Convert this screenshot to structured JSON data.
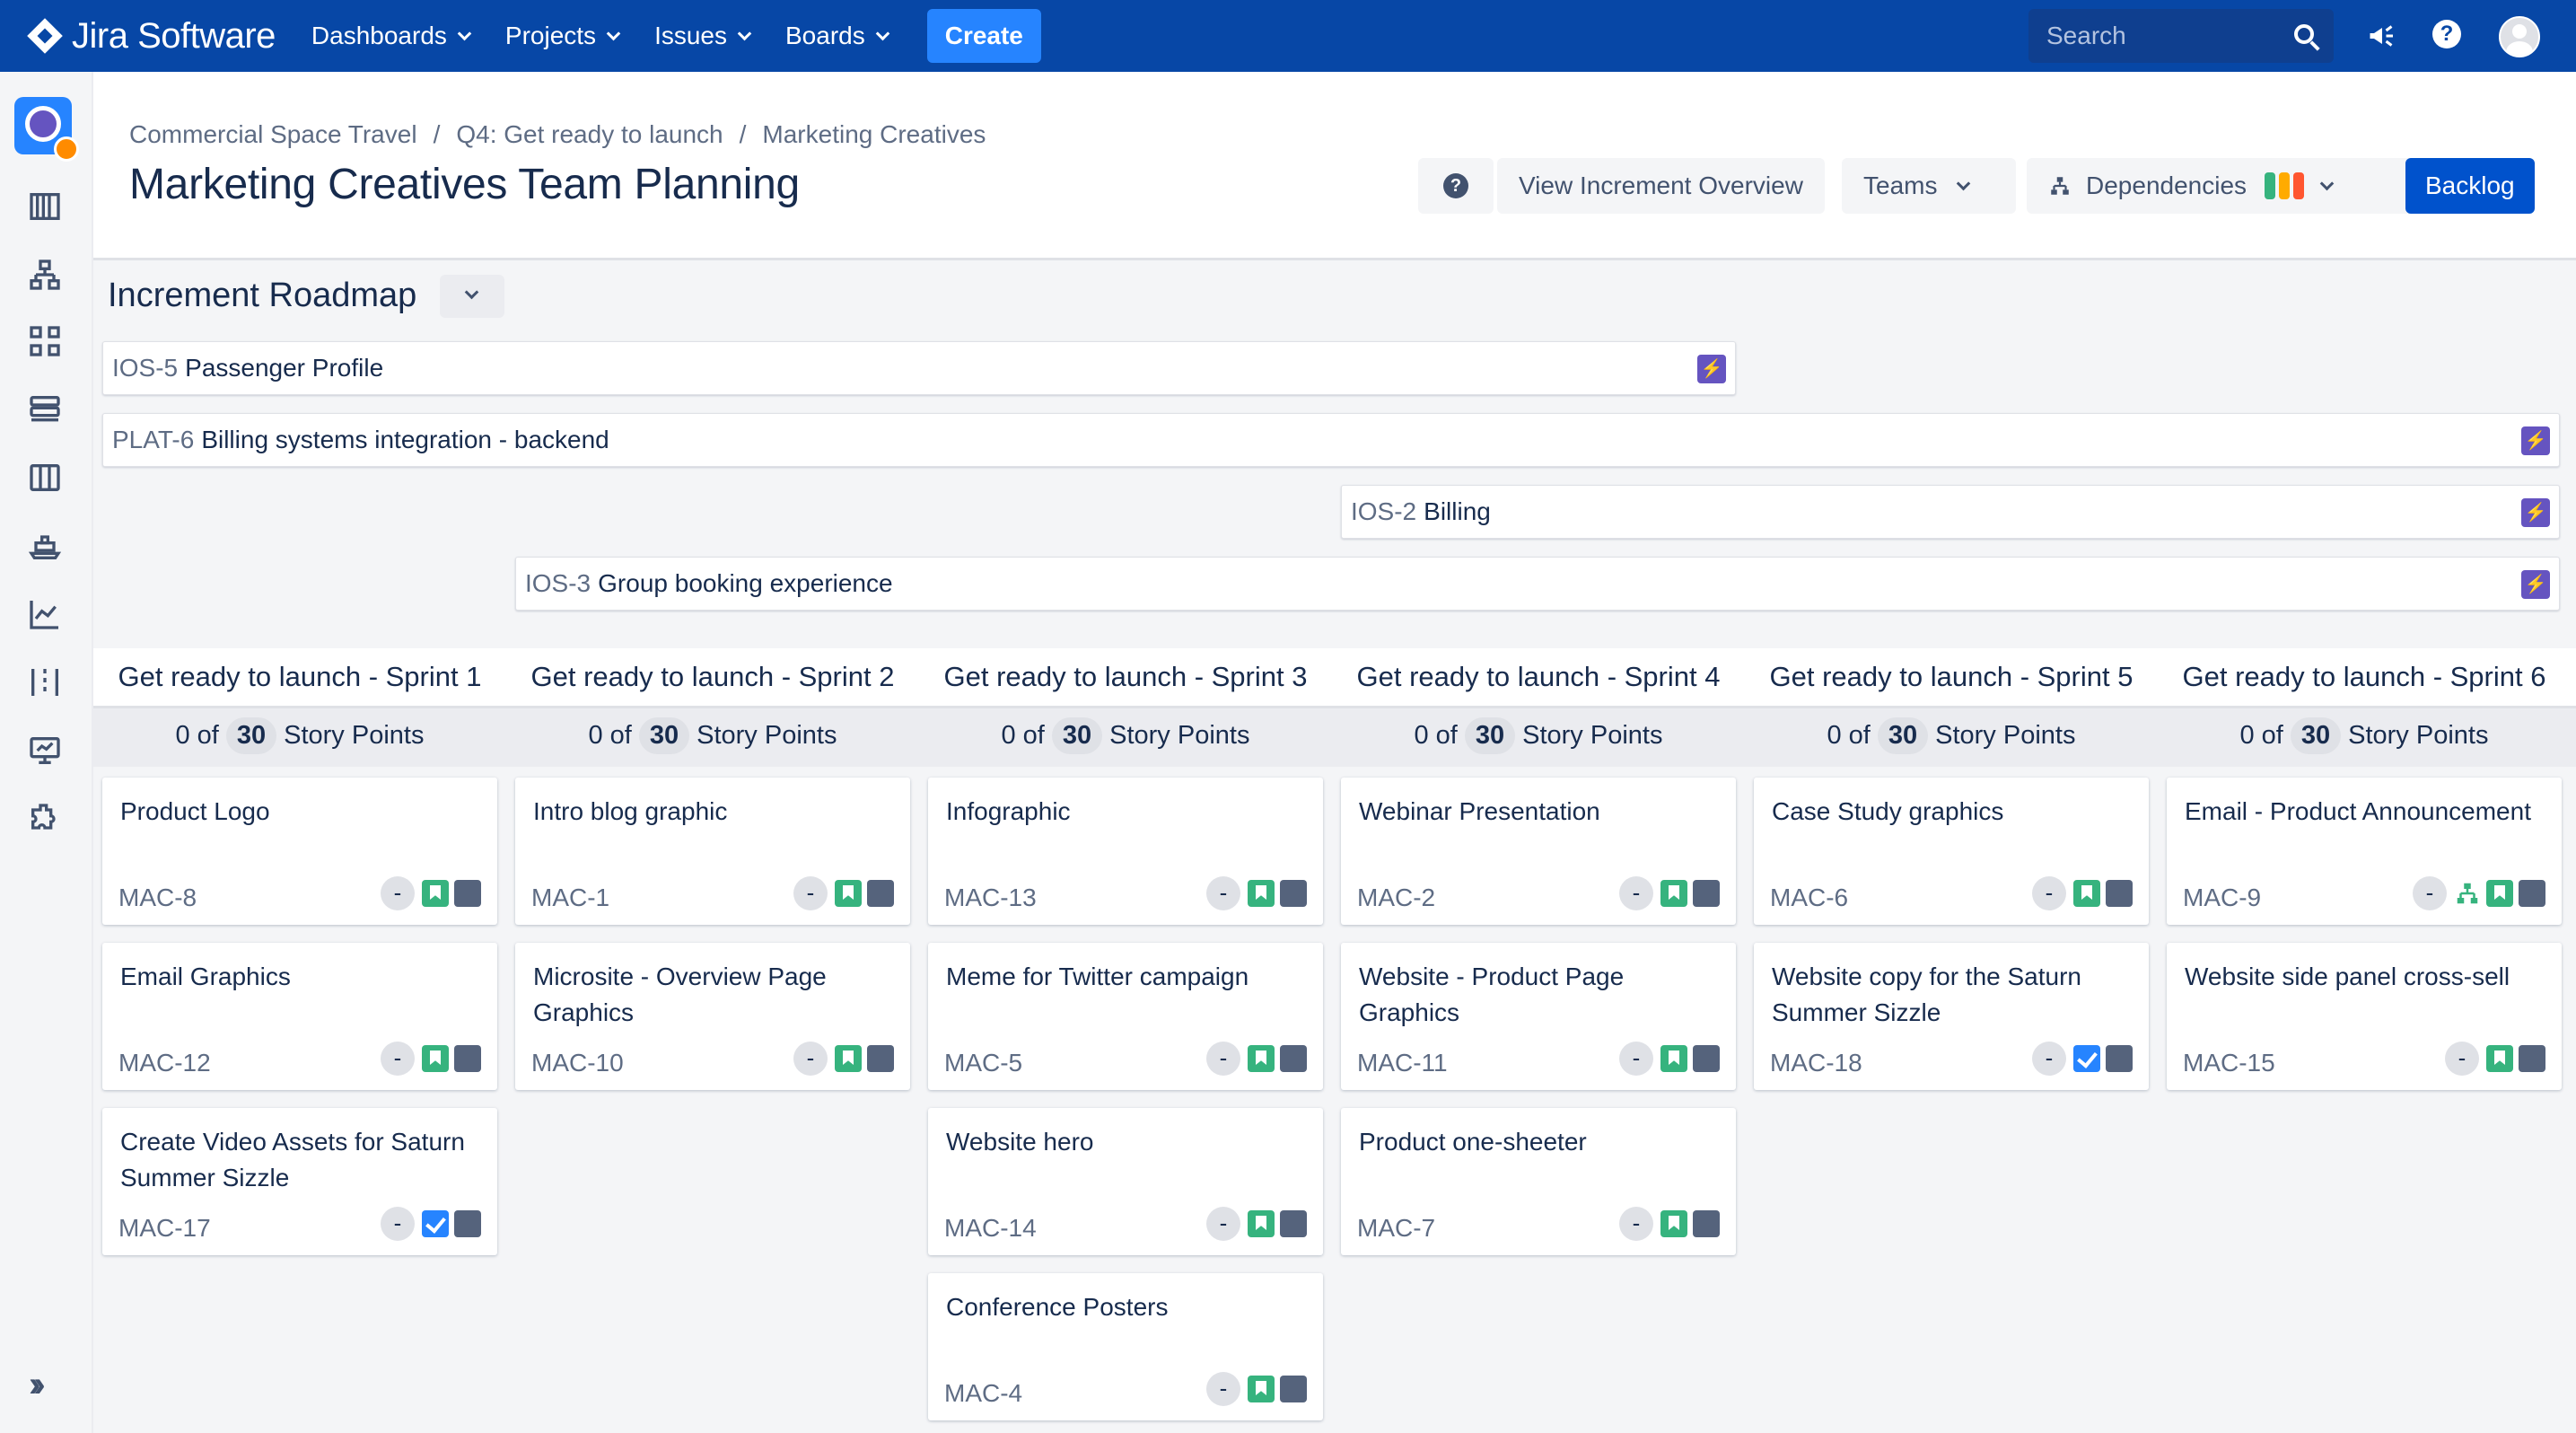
{
  "topnav": {
    "brand": "Jira Software",
    "menus": [
      {
        "label": "Dashboards"
      },
      {
        "label": "Projects"
      },
      {
        "label": "Issues"
      },
      {
        "label": "Boards"
      }
    ],
    "create_label": "Create",
    "search_placeholder": "Search",
    "icons": [
      "megaphone-icon",
      "help-icon",
      "avatar"
    ]
  },
  "breadcrumb": [
    "Commercial Space Travel",
    "Q4: Get ready to launch",
    "Marketing Creatives"
  ],
  "page_title": "Marketing Creatives Team Planning",
  "header_buttons": {
    "help": "?",
    "increment_overview": "View Increment Overview",
    "teams": "Teams",
    "dependencies": "Dependencies",
    "dependency_colors": [
      "#36b37e",
      "#ffab00",
      "#ff5630"
    ],
    "backlog": "Backlog"
  },
  "roadmap": {
    "title": "Increment Roadmap",
    "epics": [
      {
        "key": "IOS-5",
        "name": "Passenger Profile"
      },
      {
        "key": "PLAT-6",
        "name": "Billing systems integration - backend"
      },
      {
        "key": "IOS-2",
        "name": "Billing"
      },
      {
        "key": "IOS-3",
        "name": "Group booking experience"
      }
    ]
  },
  "sprints": [
    {
      "title": "Get ready to launch - Sprint 1",
      "done": "0",
      "total": "30",
      "of": "of",
      "unit": "Story Points",
      "cards": [
        {
          "title": "Product Logo",
          "key": "MAC-8",
          "estimate": "-",
          "type": "story"
        },
        {
          "title": "Email Graphics",
          "key": "MAC-12",
          "estimate": "-",
          "type": "story"
        },
        {
          "title": "Create Video Assets for Saturn Summer Sizzle",
          "key": "MAC-17",
          "estimate": "-",
          "type": "task"
        }
      ]
    },
    {
      "title": "Get ready to launch - Sprint 2",
      "done": "0",
      "total": "30",
      "of": "of",
      "unit": "Story Points",
      "cards": [
        {
          "title": "Intro blog graphic",
          "key": "MAC-1",
          "estimate": "-",
          "type": "story"
        },
        {
          "title": "Microsite - Overview Page Graphics",
          "key": "MAC-10",
          "estimate": "-",
          "type": "story"
        }
      ]
    },
    {
      "title": "Get ready to launch - Sprint 3",
      "done": "0",
      "total": "30",
      "of": "of",
      "unit": "Story Points",
      "cards": [
        {
          "title": "Infographic",
          "key": "MAC-13",
          "estimate": "-",
          "type": "story"
        },
        {
          "title": "Meme for Twitter campaign",
          "key": "MAC-5",
          "estimate": "-",
          "type": "story"
        },
        {
          "title": "Website hero",
          "key": "MAC-14",
          "estimate": "-",
          "type": "story"
        },
        {
          "title": "Conference Posters",
          "key": "MAC-4",
          "estimate": "-",
          "type": "story"
        }
      ]
    },
    {
      "title": "Get ready to launch - Sprint 4",
      "done": "0",
      "total": "30",
      "of": "of",
      "unit": "Story Points",
      "cards": [
        {
          "title": "Webinar Presentation",
          "key": "MAC-2",
          "estimate": "-",
          "type": "story"
        },
        {
          "title": "Website - Product Page Graphics",
          "key": "MAC-11",
          "estimate": "-",
          "type": "story"
        },
        {
          "title": "Product one-sheeter",
          "key": "MAC-7",
          "estimate": "-",
          "type": "story"
        }
      ]
    },
    {
      "title": "Get ready to launch - Sprint 5",
      "done": "0",
      "total": "30",
      "of": "of",
      "unit": "Story Points",
      "cards": [
        {
          "title": "Case Study graphics",
          "key": "MAC-6",
          "estimate": "-",
          "type": "story"
        },
        {
          "title": "Website copy for the Saturn Summer Sizzle",
          "key": "MAC-18",
          "estimate": "-",
          "type": "task"
        }
      ]
    },
    {
      "title": "Get ready to launch - Sprint 6",
      "done": "0",
      "total": "30",
      "of": "of",
      "unit": "Story Points",
      "cards": [
        {
          "title": "Email - Product Announcement",
          "key": "MAC-9",
          "estimate": "-",
          "type": "story",
          "dependency": true
        },
        {
          "title": "Website side panel cross-sell",
          "key": "MAC-15",
          "estimate": "-",
          "type": "story"
        }
      ]
    }
  ],
  "colors": {
    "nav": "#0747a6",
    "primary": "#0052cc",
    "epic": "#6554c0",
    "story": "#36b37e",
    "task": "#2684ff"
  }
}
